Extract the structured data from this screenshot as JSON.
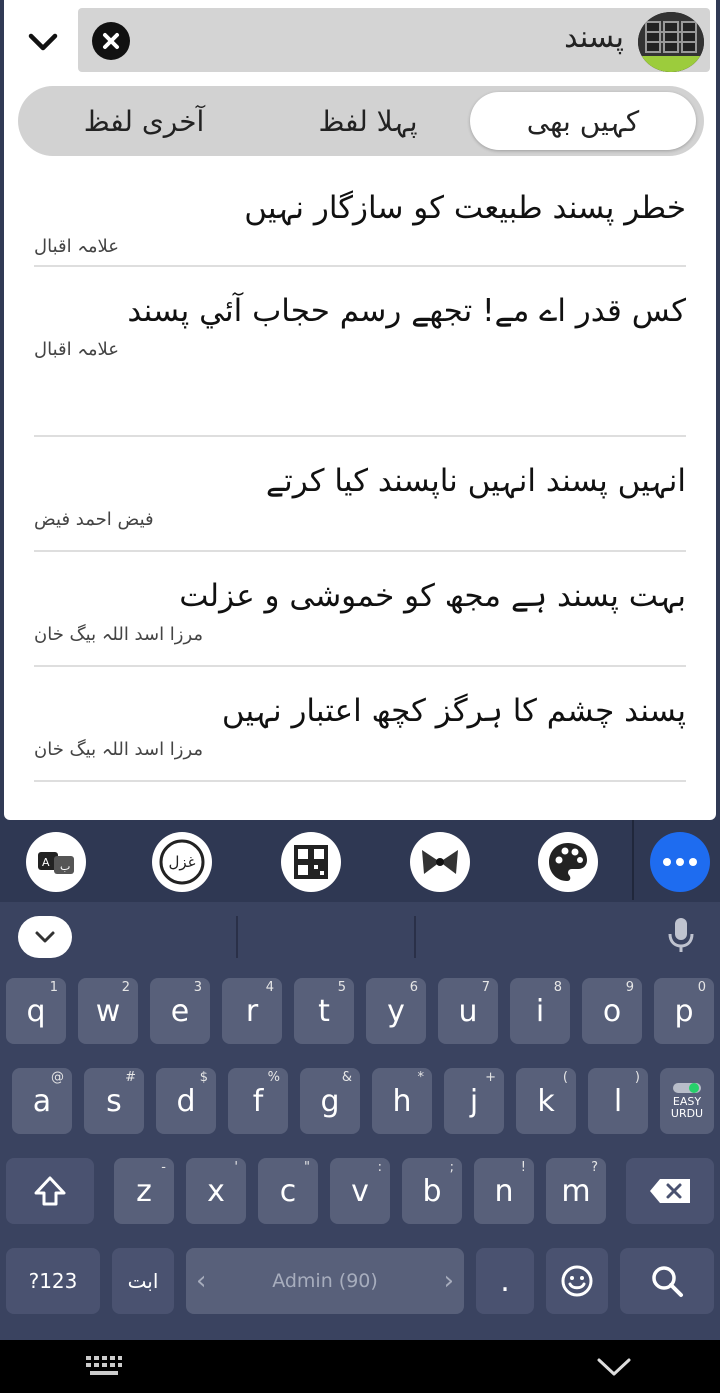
{
  "search": {
    "query": "پسند",
    "collapse_icon": "chevron-down-icon",
    "clear_icon": "close-circle-icon",
    "logo_icon": "app-logo-icon"
  },
  "filter_tabs": [
    {
      "label": "کہیں بھی",
      "active": true
    },
    {
      "label": "پہلا لفظ",
      "active": false
    },
    {
      "label": "آخری لفظ",
      "active": false
    }
  ],
  "results": [
    {
      "verse": "خطر پسند طبیعت کو سازگار نہیں",
      "poet": "علامہ اقبال"
    },
    {
      "verse": "کس قدر اے مے! تجھے رسم حجاب آئي پسند",
      "poet": "علامہ اقبال"
    },
    {
      "verse": "انہیں پسند انہیں ناپسند کیا کرتے",
      "poet": "فیض احمد فیض"
    },
    {
      "verse": "بہت پسند ہے مجھ کو خموشی و عزلت",
      "poet": "مرزا اسد اللہ بیگ خان"
    },
    {
      "verse": "پسند چشم کا ہرگز کچھ اعتبار نہیں",
      "poet": "مرزا اسد اللہ بیگ خان"
    }
  ],
  "toolbar": {
    "icons": [
      "translate-icon",
      "ghazal-icon",
      "qr-icon",
      "bow-icon",
      "palette-icon",
      "more-icon"
    ],
    "ghazal_text": "غزل",
    "more_color": "#1e6cf0"
  },
  "keyboard": {
    "row1": [
      {
        "k": "q",
        "h": "1"
      },
      {
        "k": "w",
        "h": "2"
      },
      {
        "k": "e",
        "h": "3"
      },
      {
        "k": "r",
        "h": "4"
      },
      {
        "k": "t",
        "h": "5"
      },
      {
        "k": "y",
        "h": "6"
      },
      {
        "k": "u",
        "h": "7"
      },
      {
        "k": "i",
        "h": "8"
      },
      {
        "k": "o",
        "h": "9"
      },
      {
        "k": "p",
        "h": "0"
      }
    ],
    "row2": [
      {
        "k": "a",
        "h": "@"
      },
      {
        "k": "s",
        "h": "#"
      },
      {
        "k": "d",
        "h": "$"
      },
      {
        "k": "f",
        "h": "%"
      },
      {
        "k": "g",
        "h": "&"
      },
      {
        "k": "h",
        "h": "*"
      },
      {
        "k": "j",
        "h": "+"
      },
      {
        "k": "k",
        "h": "("
      },
      {
        "k": "l",
        "h": ")"
      }
    ],
    "row3": [
      {
        "k": "z",
        "h": "-"
      },
      {
        "k": "x",
        "h": "'"
      },
      {
        "k": "c",
        "h": "\""
      },
      {
        "k": "v",
        "h": ":"
      },
      {
        "k": "b",
        "h": ";"
      },
      {
        "k": "n",
        "h": "!"
      },
      {
        "k": "m",
        "h": "?"
      }
    ],
    "easy_urdu_label_1": "EASY",
    "easy_urdu_label_2": "URDU",
    "symbols_label": "?123",
    "urdu_abc_label": "ابت",
    "space_label": "Admin (90)",
    "period_label": ".",
    "accent_color": "#27d06b"
  },
  "navbar": {
    "keyboard_icon": "keyboard-icon",
    "back_icon": "chevron-down-icon"
  }
}
